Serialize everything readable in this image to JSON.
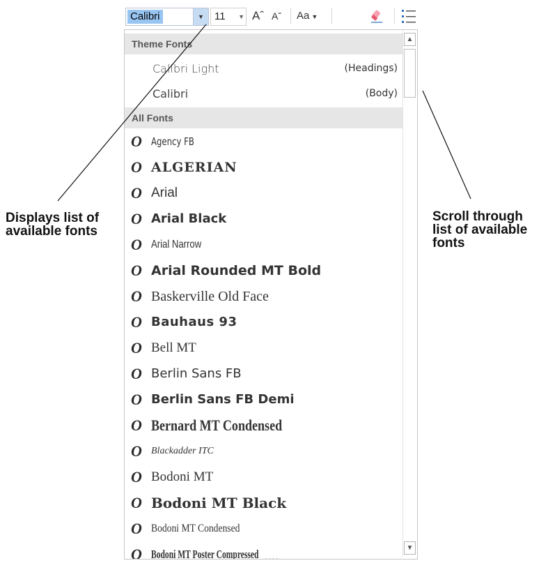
{
  "toolbar": {
    "font_name": "Calibri",
    "font_size": "11",
    "grow_font_icon": "Aˆ",
    "shrink_font_icon": "Aˇ",
    "change_case_label": "Aa",
    "icons": [
      "dropdown-arrow-icon",
      "grow-font-icon",
      "shrink-font-icon",
      "change-case-icon",
      "clear-formatting-icon",
      "bullets-icon"
    ]
  },
  "dropdown": {
    "theme_header": "Theme Fonts",
    "theme_fonts": [
      {
        "name": "Calibri Light",
        "role": "(Headings)"
      },
      {
        "name": "Calibri",
        "role": "(Body)"
      }
    ],
    "all_header": "All Fonts",
    "font_glyph": "O",
    "fonts": [
      "Agency FB",
      "ALGERIAN",
      "Arial",
      "Arial Black",
      "Arial Narrow",
      "Arial Rounded MT Bold",
      "Baskerville Old Face",
      "Bauhaus 93",
      "Bell MT",
      "Berlin Sans FB",
      "Berlin Sans FB Demi",
      "Bernard MT Condensed",
      "Blackadder ITC",
      "Bodoni MT",
      "Bodoni MT Black",
      "Bodoni MT Condensed",
      "Bodoni MT Poster Compressed"
    ]
  },
  "callouts": {
    "left": [
      "Displays list of",
      "available fonts"
    ],
    "right": [
      "Scroll through",
      "list of available",
      "fonts"
    ]
  }
}
